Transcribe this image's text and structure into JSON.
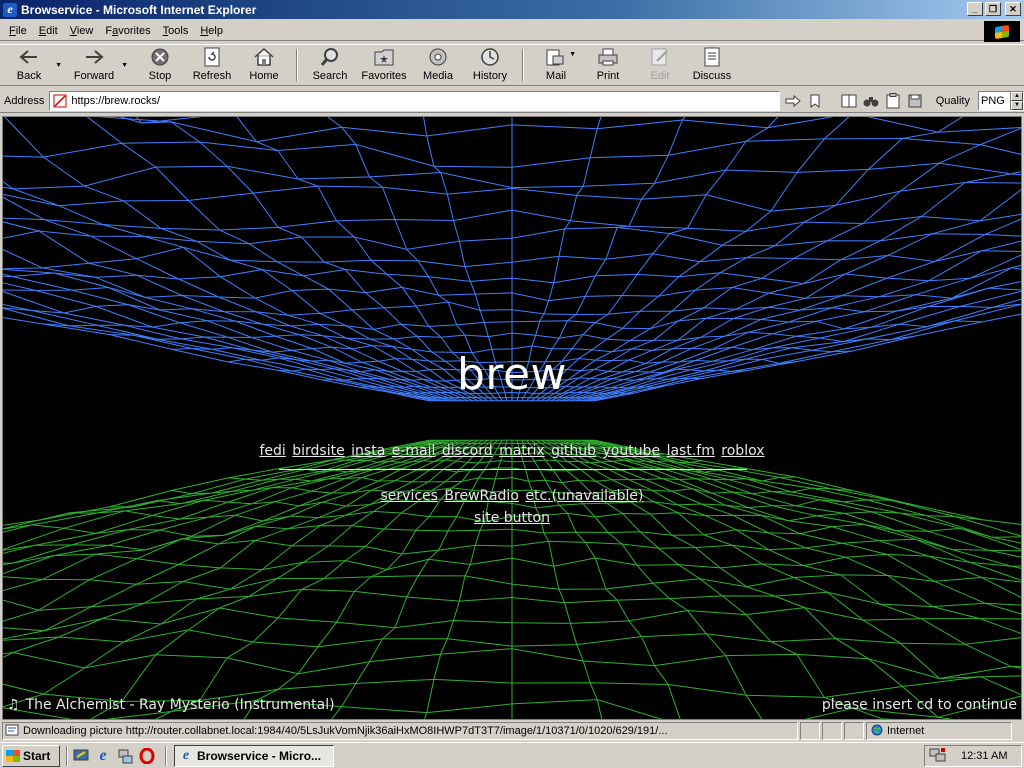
{
  "window": {
    "title": "Browservice - Microsoft Internet Explorer",
    "app_icon": "ie-icon",
    "buttons": [
      "minimize",
      "restore",
      "close"
    ]
  },
  "menu": {
    "items": [
      {
        "key": "F",
        "rest": "ile"
      },
      {
        "key": "E",
        "rest": "dit"
      },
      {
        "key": "V",
        "rest": "iew"
      },
      {
        "key": "",
        "pre": "F",
        "uline": "a",
        "post": "vorites"
      },
      {
        "key": "T",
        "rest": "ools"
      },
      {
        "key": "H",
        "rest": "elp"
      }
    ]
  },
  "toolbar": {
    "back": "Back",
    "forward": "Forward",
    "stop": "Stop",
    "refresh": "Refresh",
    "home": "Home",
    "search": "Search",
    "favorites": "Favorites",
    "media": "Media",
    "history": "History",
    "mail": "Mail",
    "print": "Print",
    "edit": "Edit",
    "discuss": "Discuss"
  },
  "address": {
    "label": "Address",
    "url": "https://brew.rocks/",
    "quality_label": "Quality",
    "quality_value": "PNG"
  },
  "page": {
    "heading": "brew",
    "links": [
      "fedi",
      "birdsite",
      "insta",
      "e-mail",
      "discord",
      "matrix",
      "github",
      "youtube",
      "last.fm",
      "roblox"
    ],
    "links2": [
      "services",
      "BrewRadio",
      "etc.(unavailable)"
    ],
    "site_button": "site button",
    "now_playing": "The Alchemist - Ray Mysterio (Instrumental)",
    "insert_cd": "please insert cd to continue",
    "colors": {
      "sky_wire": "#3f7fff",
      "ground_wire": "#2fb02f",
      "background": "#000000"
    }
  },
  "status": {
    "text": "Downloading picture http://router.collabnet.local:1984/40/5LsJukVomNjik36aiHxMO8IHWP7dT3T7/image/1/10371/0/1020/629/191/...",
    "zone": "Internet"
  },
  "taskbar": {
    "start": "Start",
    "task": "Browservice - Micro...",
    "clock": "12:31 AM"
  }
}
